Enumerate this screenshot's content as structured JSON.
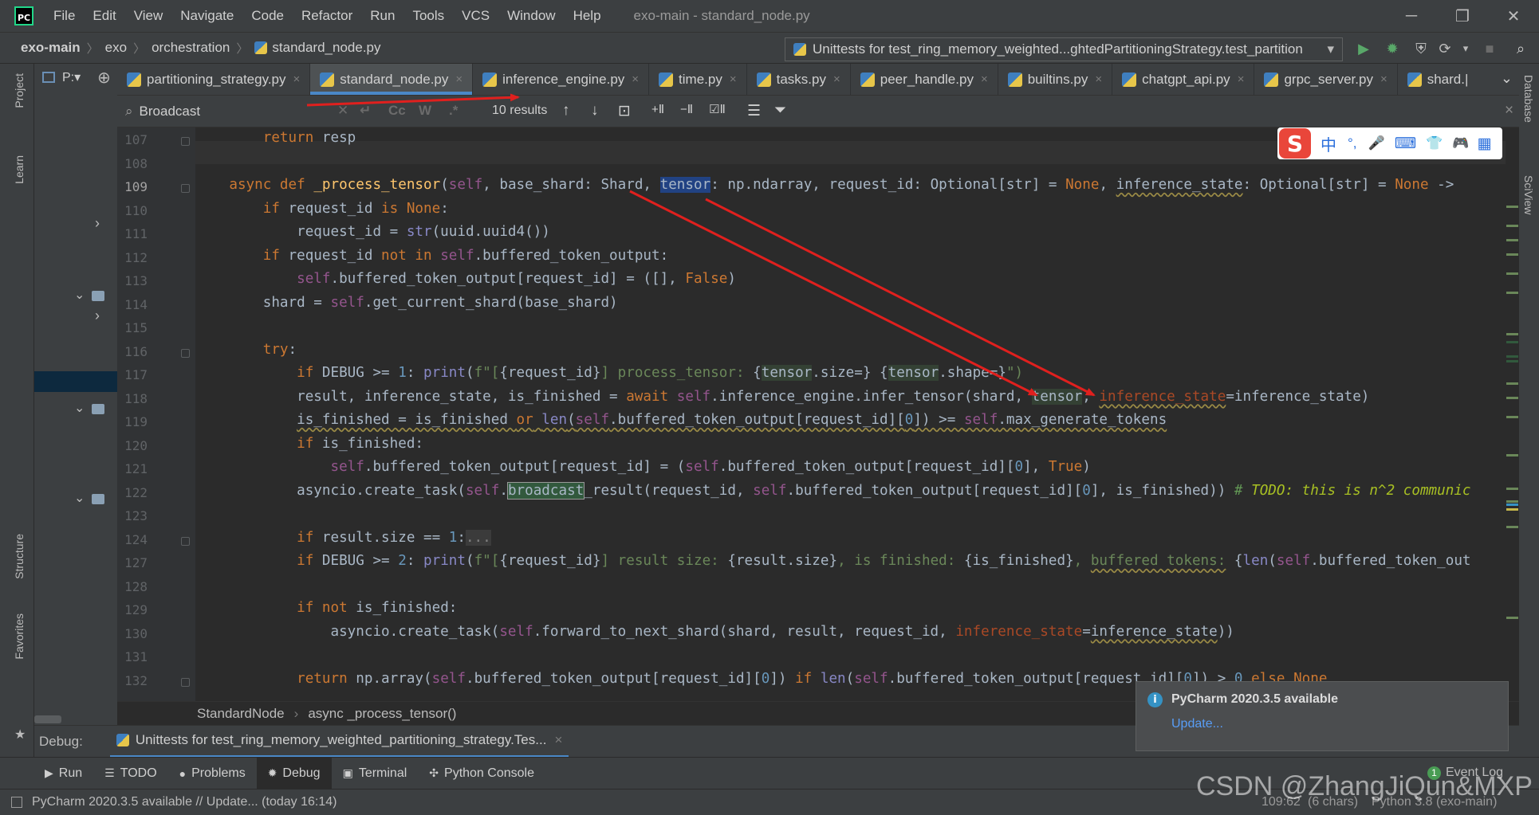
{
  "titlebar": {
    "logo": "PC",
    "menu": [
      "File",
      "Edit",
      "View",
      "Navigate",
      "Code",
      "Refactor",
      "Run",
      "Tools",
      "VCS",
      "Window",
      "Help"
    ],
    "window_title": "exo-main - standard_node.py",
    "controls": {
      "minimize": "─",
      "restore": "❐",
      "close": "✕"
    }
  },
  "navbar": {
    "breadcrumbs": [
      "exo-main",
      "exo",
      "orchestration",
      "standard_node.py"
    ],
    "run_config": "Unittests for test_ring_memory_weighted...ghtedPartitioningStrategy.test_partition",
    "run_config_arrow": "▾",
    "toolbar_icons": [
      "▶",
      "✹",
      "⛨",
      "⟳",
      "▾",
      "■",
      "⌕"
    ],
    "toolbar_colors": {
      "run": "#59a869",
      "debug": "#59a869"
    }
  },
  "left_tools": {
    "project": "Project",
    "learn": "Learn",
    "structure": "Structure",
    "favorites": "Favorites",
    "star": "★"
  },
  "right_tools": {
    "database": "Database",
    "sciview": "SciView"
  },
  "project_panel": {
    "header": "P:▾",
    "target_icon": "⊕",
    "expanders": [
      "›",
      "⌄",
      "›",
      "⌄",
      "⌄"
    ]
  },
  "tabs": [
    {
      "label": "partitioning_strategy.py",
      "active": false
    },
    {
      "label": "standard_node.py",
      "active": true
    },
    {
      "label": "inference_engine.py",
      "active": false
    },
    {
      "label": "time.py",
      "active": false
    },
    {
      "label": "tasks.py",
      "active": false
    },
    {
      "label": "peer_handle.py",
      "active": false
    },
    {
      "label": "builtins.py",
      "active": false
    },
    {
      "label": "chatgpt_api.py",
      "active": false
    },
    {
      "label": "grpc_server.py",
      "active": false
    },
    {
      "label": "shard.|",
      "active": false
    }
  ],
  "tab_overflow": "⌄",
  "tab_close": "×",
  "search": {
    "query": "Broadcast",
    "results": "10 results",
    "search_icon": "⌕",
    "field_icons": {
      "clear": "✕",
      "replace": "↵"
    },
    "options": [
      "Cc",
      "W",
      ".*"
    ],
    "nav_icons": [
      "↑",
      "↓",
      "⊡",
      "+Ⅱ",
      "−Ⅱ",
      "☑Ⅱ",
      "☰",
      "⏷"
    ],
    "close": "×"
  },
  "editor": {
    "current_line": 109,
    "line_numbers": [
      107,
      108,
      109,
      110,
      111,
      112,
      113,
      114,
      115,
      116,
      117,
      118,
      119,
      120,
      121,
      122,
      123,
      124,
      127,
      128,
      129,
      130,
      131,
      132
    ],
    "breadcrumb": [
      "StandardNode",
      "async _process_tensor()"
    ],
    "breadcrumb_sep": "›"
  },
  "debug": {
    "label": "Debug:",
    "session": "Unittests for test_ring_memory_weighted_partitioning_strategy.Tes...",
    "close": "×"
  },
  "bottom_tools": [
    {
      "icon": "▶",
      "label": "Run",
      "active": false
    },
    {
      "icon": "☰",
      "label": "TODO",
      "active": false
    },
    {
      "icon": "●",
      "label": "Problems",
      "active": false
    },
    {
      "icon": "✹",
      "label": "Debug",
      "active": true
    },
    {
      "icon": "▣",
      "label": "Terminal",
      "active": false
    },
    {
      "icon": "✣",
      "label": "Python Console",
      "active": false
    }
  ],
  "event_log": {
    "count": "1",
    "label": "Event Log"
  },
  "status": {
    "message": "PyCharm 2020.3.5 available // Update... (today 16:14)",
    "position": "109:62",
    "encoding": "(6 chars)",
    "interpreter": "Python 3.8 (exo-main)"
  },
  "notification": {
    "title": "PyCharm 2020.3.5 available",
    "link": "Update...",
    "icon": "i",
    "accent": "#3592c4"
  },
  "ime": {
    "icons": [
      "S",
      "中",
      "°,",
      "🎤",
      "⌨",
      "👕",
      "🎮",
      "▦"
    ],
    "brand_color": "#e9463a"
  },
  "watermark": "CSDN @ZhangJiQun&MXP",
  "annotation_color": "#e0201e"
}
